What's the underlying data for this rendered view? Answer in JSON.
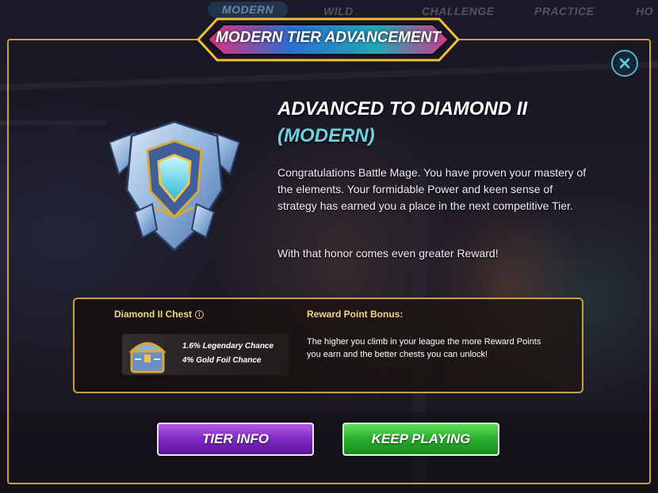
{
  "top_tabs": [
    "MODERN",
    "WILD",
    "CHALLENGE",
    "PRACTICE",
    "HO"
  ],
  "modal": {
    "title": "MODERN TIER ADVANCEMENT",
    "heading": "ADVANCED TO DIAMOND II",
    "subheading": "(MODERN)",
    "message": "Congratulations Battle Mage. You have proven your mastery of the elements. Your formidable Power and keen sense of strategy has earned you a place in the next competitive Tier.",
    "message2": "With that honor comes even greater Reward!",
    "close_icon": "close-icon",
    "badge_icon": "diamond-league-badge-icon"
  },
  "rewards": {
    "chest_title": "Diamond II Chest",
    "info_icon": "i",
    "legendary_chance": "1.6% Legendary Chance",
    "gold_foil_chance": "4% Gold Foil Chance",
    "bonus_title": "Reward Point Bonus:",
    "bonus_text": "The higher you climb in your league the more Reward Points you earn and the better chests you can unlock!"
  },
  "buttons": {
    "tier_info": "TIER INFO",
    "keep_playing": "KEEP PLAYING"
  },
  "colors": {
    "gold_border": "#c9a03b",
    "accent_cyan": "#6fd1e0",
    "purple_button": "#7d28c2",
    "green_button": "#2aad2e"
  }
}
